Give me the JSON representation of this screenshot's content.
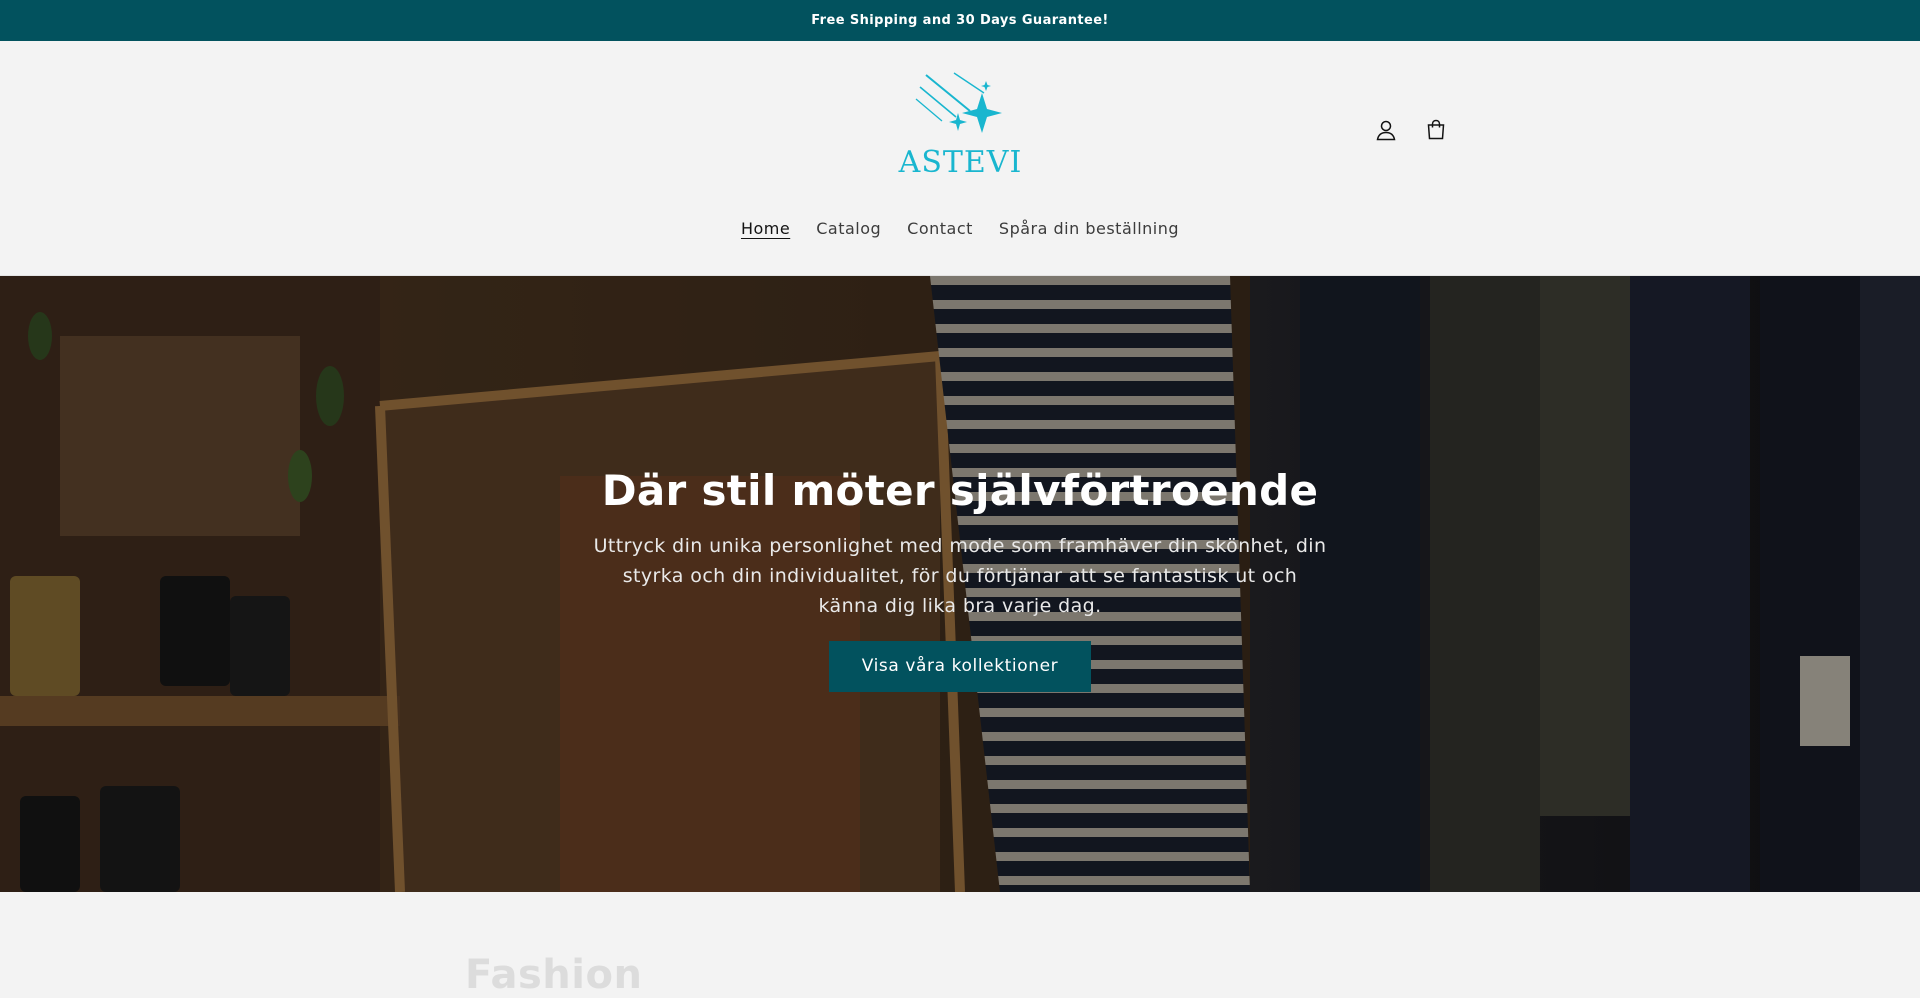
{
  "announcement": {
    "text": "Free Shipping and 30 Days Guarantee!"
  },
  "brand": {
    "name": "ASTEVI",
    "accent_color": "#19b6cf",
    "primary_color": "#02525e"
  },
  "header_icons": [
    {
      "name": "account-icon"
    },
    {
      "name": "cart-icon"
    }
  ],
  "nav": {
    "items": [
      {
        "label": "Home",
        "active": true
      },
      {
        "label": "Catalog",
        "active": false
      },
      {
        "label": "Contact",
        "active": false
      },
      {
        "label": "Spåra din beställning",
        "active": false
      }
    ]
  },
  "hero": {
    "title": "Där stil möter självförtroende",
    "text": "Uttryck din unika personlighet med mode som framhäver din skönhet, din styrka och din individualitet, för du förtjänar att se fantastisk ut och känna dig lika bra varje dag.",
    "button_label": "Visa våra kollektioner"
  },
  "next_section": {
    "title": "Fashion"
  }
}
